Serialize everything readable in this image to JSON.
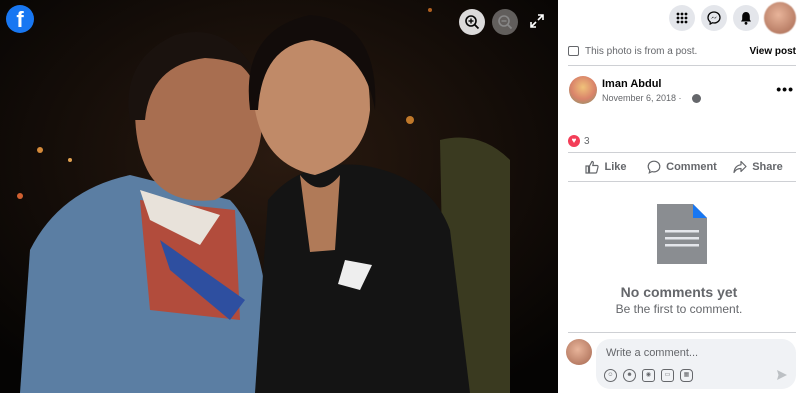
{
  "viewer": {
    "logo": "f",
    "icons": [
      "zoom-in-icon",
      "zoom-out-icon",
      "expand-icon"
    ]
  },
  "topbar": {
    "icons": [
      "menu-grid-icon",
      "messenger-icon",
      "bell-icon"
    ]
  },
  "post": {
    "note": "This photo is from a post.",
    "view_post": "View post",
    "author": "Iman Abdul",
    "date": "November 6, 2018 ·",
    "more": "•••",
    "reactions_count": "3"
  },
  "actions": {
    "like": "Like",
    "comment": "Comment",
    "share": "Share"
  },
  "comments": {
    "empty_title": "No comments yet",
    "empty_sub": "Be the first to comment."
  },
  "composer": {
    "placeholder": "Write a comment...",
    "tools": [
      "avatar-icon",
      "emoji-icon",
      "camera-icon",
      "gif-icon",
      "sticker-icon"
    ]
  },
  "colors": {
    "brand": "#1877f2",
    "heart": "#f33e58"
  }
}
